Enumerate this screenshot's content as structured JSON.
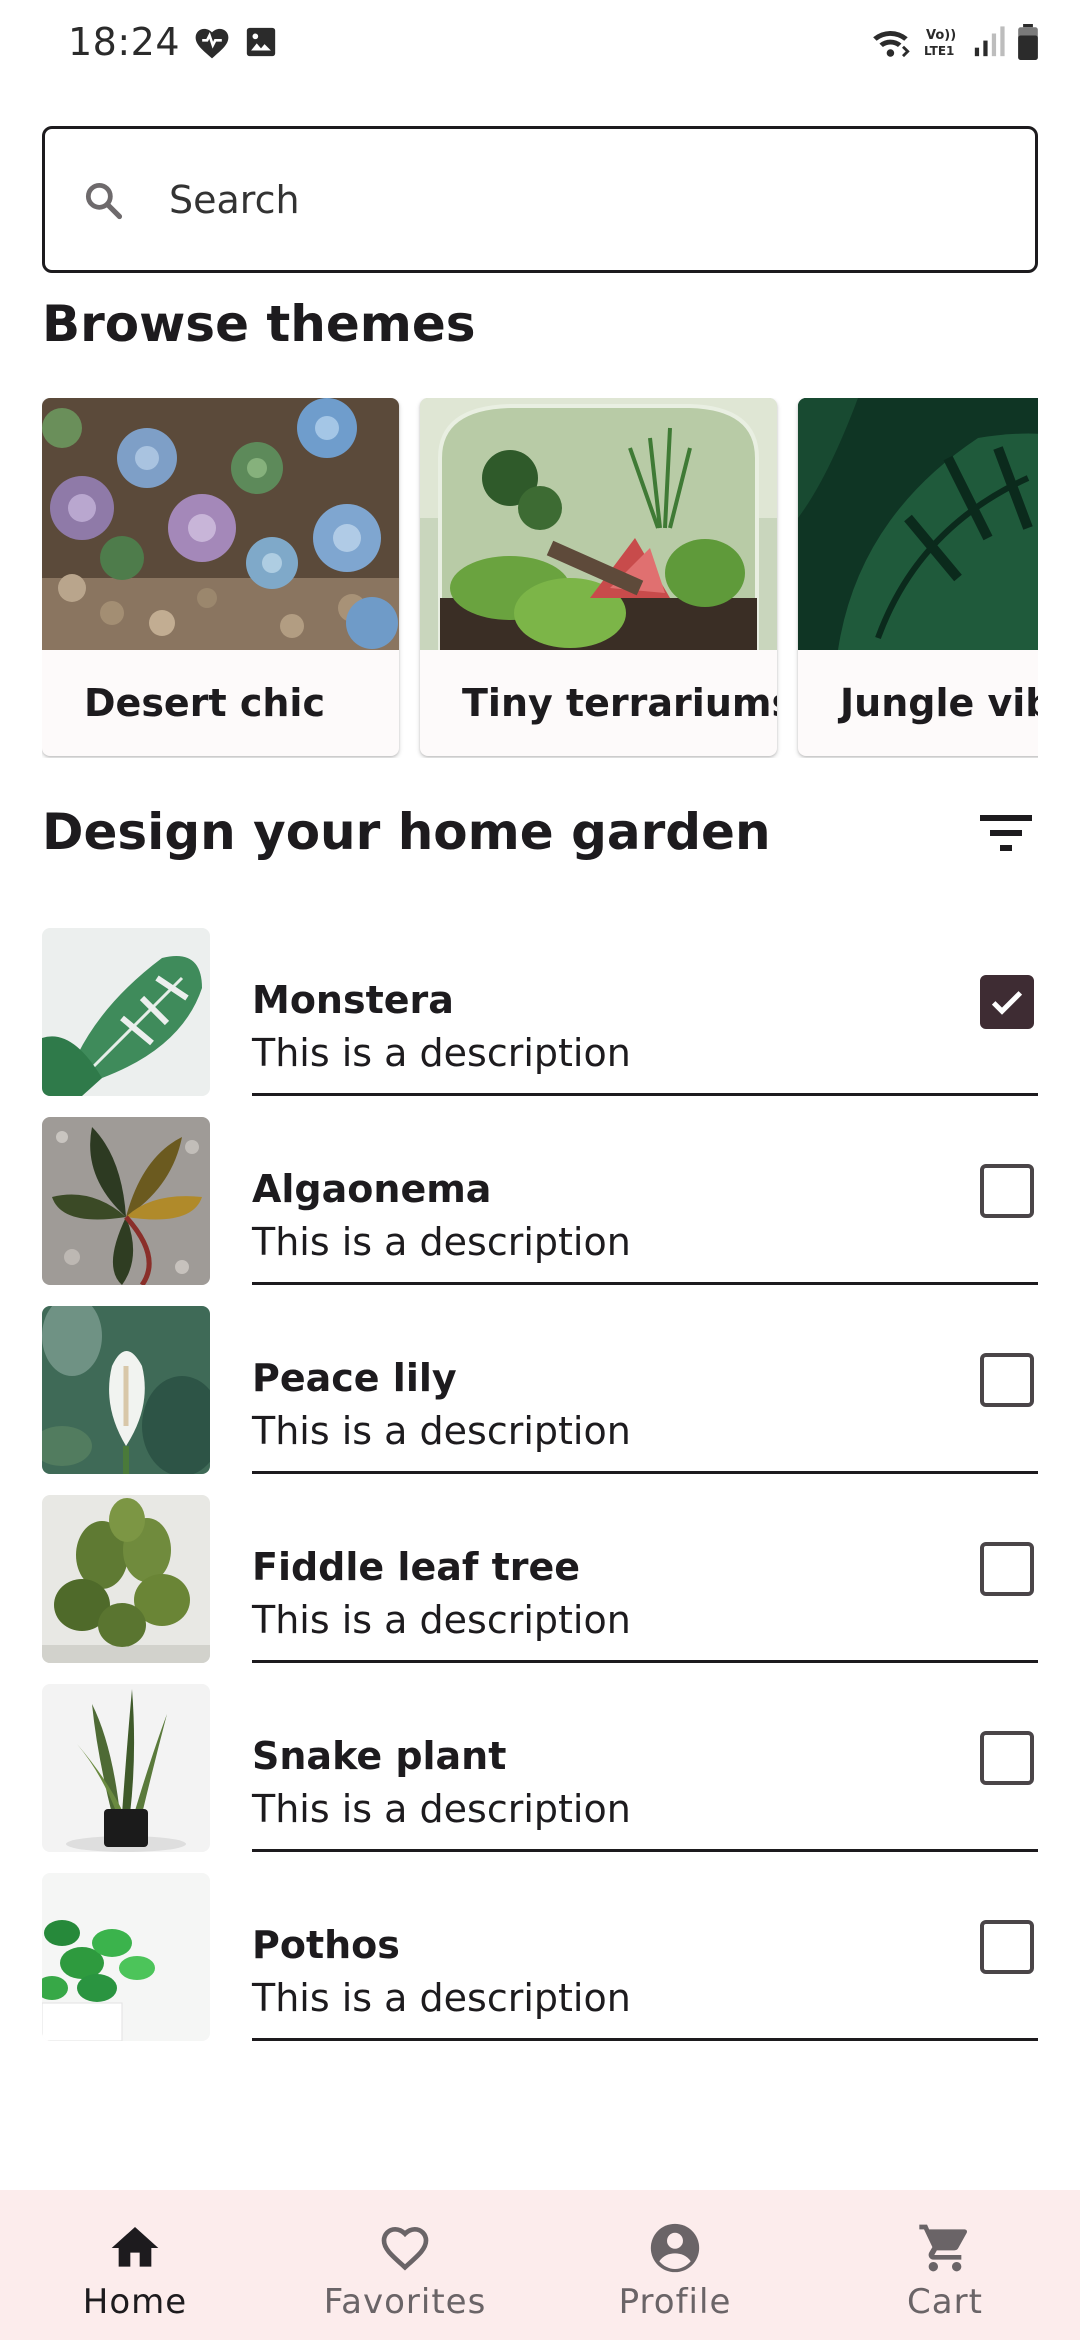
{
  "status_bar": {
    "time": "18:24",
    "icons_left": [
      "heart-icon",
      "image-icon"
    ],
    "icons_right": [
      "wifi-calling-icon",
      "volte-icon",
      "signal-icon",
      "battery-icon"
    ],
    "volte_text": "Vo)) LTE1"
  },
  "search": {
    "placeholder": "Search",
    "icon": "search-icon"
  },
  "browse": {
    "title": "Browse themes",
    "themes": [
      {
        "label": "Desert chic",
        "image": "succulents-image"
      },
      {
        "label": "Tiny terrariums",
        "image": "terrarium-image"
      },
      {
        "label": "Jungle vibes",
        "image": "monstera-leaves-image"
      }
    ]
  },
  "garden": {
    "title": "Design your home garden",
    "filter_icon": "filter-icon",
    "plants": [
      {
        "name": "Monstera",
        "description": "This is a description",
        "checked": true,
        "image": "monstera-image"
      },
      {
        "name": "Algaonema",
        "description": "This is a description",
        "checked": false,
        "image": "aglaonema-image"
      },
      {
        "name": "Peace lily",
        "description": "This is a description",
        "checked": false,
        "image": "peace-lily-image"
      },
      {
        "name": "Fiddle leaf tree",
        "description": "This is a description",
        "checked": false,
        "image": "fiddle-leaf-image"
      },
      {
        "name": "Snake plant",
        "description": "This is a description",
        "checked": false,
        "image": "snake-plant-image"
      },
      {
        "name": "Pothos",
        "description": "This is a description",
        "checked": false,
        "image": "pothos-image"
      }
    ]
  },
  "bottom_nav": {
    "items": [
      {
        "label": "Home",
        "icon": "home-icon",
        "active": true
      },
      {
        "label": "Favorites",
        "icon": "heart-outline-icon",
        "active": false
      },
      {
        "label": "Profile",
        "icon": "account-circle-icon",
        "active": false
      },
      {
        "label": "Cart",
        "icon": "cart-icon",
        "active": false
      }
    ]
  },
  "colors": {
    "text": "#1d1b1e",
    "checkbox_checked": "#3e2c33",
    "nav_background": "#fcecec",
    "card_background": "#fdfafa"
  }
}
